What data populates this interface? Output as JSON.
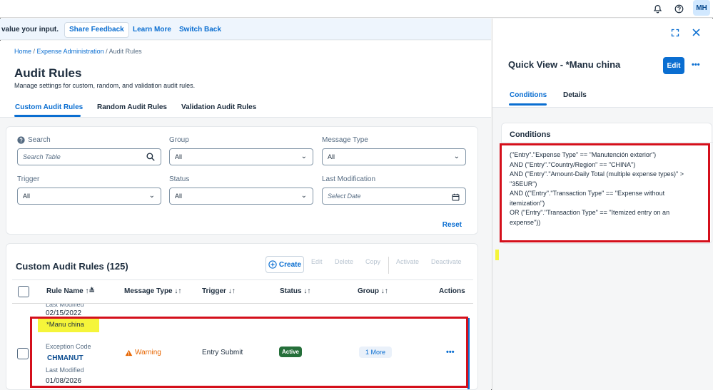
{
  "shell": {
    "avatar_initials": "MH",
    "icons": [
      "bell-icon",
      "help-icon"
    ]
  },
  "feedback": {
    "text": "value your input.",
    "share_feedback": "Share Feedback",
    "learn_more": "Learn More",
    "switch_back": "Switch Back"
  },
  "breadcrumb": {
    "home": "Home",
    "sep1": " / ",
    "expense_admin": "Expense Administration",
    "sep2": " / ",
    "current": "Audit Rules"
  },
  "page": {
    "title": "Audit Rules",
    "subtitle": "Manage settings for custom, random, and validation audit rules."
  },
  "tabs": [
    {
      "label": "Custom Audit Rules",
      "active": true
    },
    {
      "label": "Random Audit Rules",
      "active": false
    },
    {
      "label": "Validation Audit Rules",
      "active": false
    }
  ],
  "filters": {
    "search_label": "Search",
    "search_placeholder": "Search Table",
    "group_label": "Group",
    "group_value": "All",
    "message_type_label": "Message Type",
    "message_type_value": "All",
    "trigger_label": "Trigger",
    "trigger_value": "All",
    "status_label": "Status",
    "status_value": "All",
    "last_mod_label": "Last Modification",
    "last_mod_placeholder": "Select Date",
    "reset": "Reset"
  },
  "table": {
    "title": "Custom Audit Rules (125)",
    "toolbar": {
      "create": "Create",
      "edit": "Edit",
      "delete": "Delete",
      "copy": "Copy",
      "activate": "Activate",
      "deactivate": "Deactivate"
    },
    "columns": {
      "rule_name": "Rule Name",
      "message_type": "Message Type",
      "trigger": "Trigger",
      "status": "Status",
      "group": "Group",
      "actions": "Actions"
    },
    "prev_row": {
      "last_modified_label": "Last Modified",
      "last_modified": "02/15/2022"
    },
    "row": {
      "name": "*Manu china",
      "exception_code_label": "Exception Code",
      "exception_code": "CHMANUT",
      "last_modified_label": "Last Modified",
      "last_modified": "01/08/2026",
      "message_type": "Warning",
      "trigger": "Entry Submit",
      "status": "Active",
      "group": "1 More",
      "actions": "•••"
    }
  },
  "quick_view": {
    "title": "Quick View - *Manu china",
    "edit": "Edit",
    "more": "•••",
    "tabs": [
      {
        "label": "Conditions",
        "active": true
      },
      {
        "label": "Details",
        "active": false
      }
    ],
    "conditions_title": "Conditions",
    "conditions_text": "(\"Entry\".\"Expense Type\" == \"Manutención exterior\")\nAND (\"Entry\".\"Country/Region\" == \"CHINA\")\nAND (\"Entry\".\"Amount-Daily Total (multiple expense types)\" >\n\"35EUR\")\nAND ((\"Entry\".\"Transaction Type\" == \"Expense without\nitemization\")\nOR (\"Entry\".\"Transaction Type\" == \"Itemized entry on an\nexpense\"))"
  },
  "colors": {
    "accent": "#0a6ed1",
    "highlight_red": "#d40f1b",
    "highlight_yellow": "#f5f53a",
    "active_green": "#256f3a",
    "warning_orange": "#e76500"
  }
}
